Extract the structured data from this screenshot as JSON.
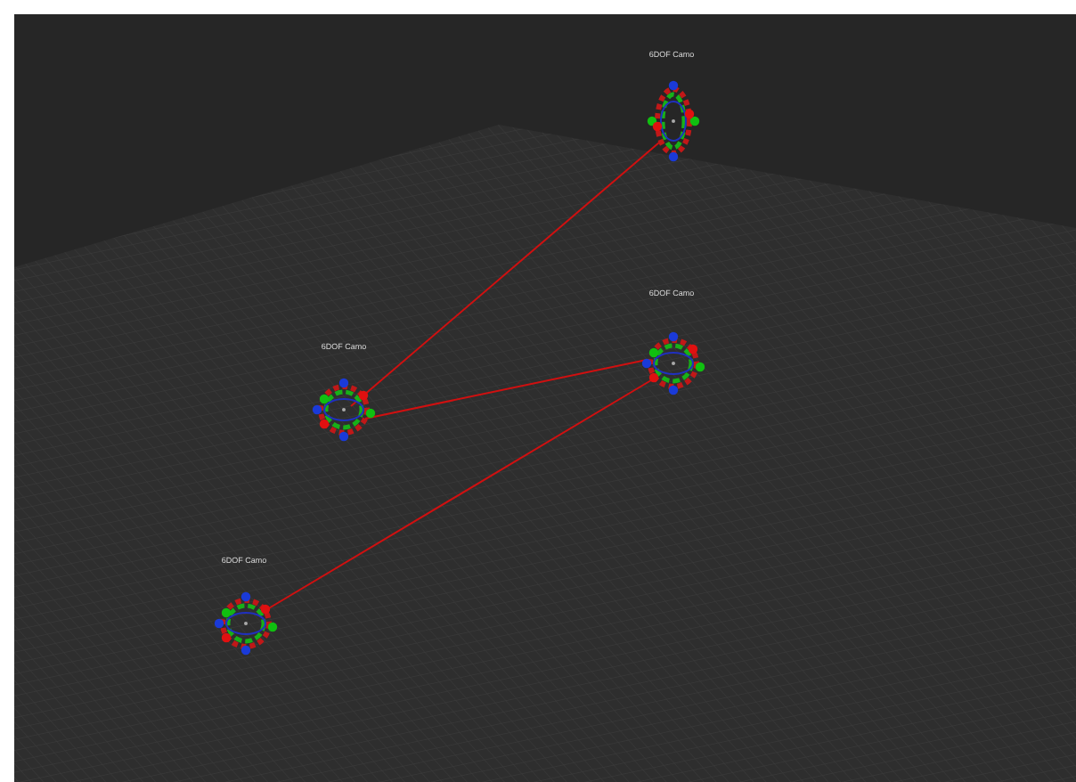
{
  "viewport": {
    "nodes": [
      {
        "label": "6DOF Camo"
      },
      {
        "label": "6DOF Camo"
      },
      {
        "label": "6DOF Camo"
      },
      {
        "label": "6DOF Camo"
      }
    ]
  }
}
